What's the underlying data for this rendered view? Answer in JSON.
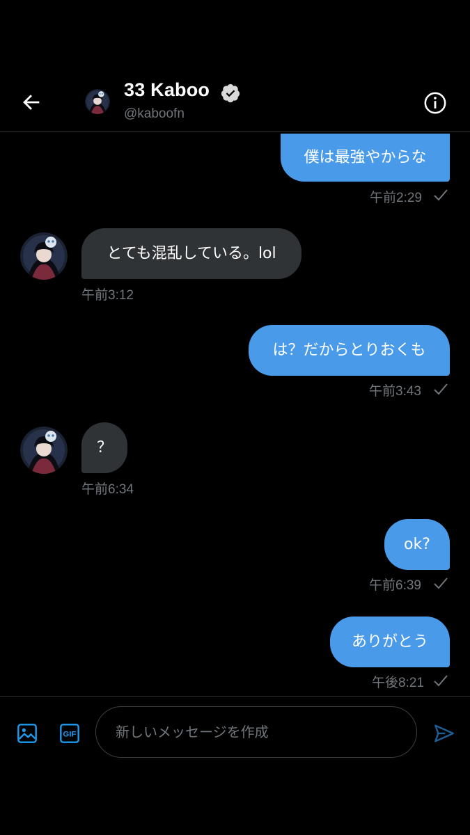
{
  "header": {
    "display_name": "33 Kaboo",
    "handle": "@kaboofn",
    "back_icon": "arrow-left-icon",
    "verified_icon": "verified-badge-icon",
    "info_icon": "info-circle-icon"
  },
  "messages": [
    {
      "direction": "sent",
      "text": "僕は最強やからな",
      "time": "午前2:29",
      "read": true
    },
    {
      "direction": "received",
      "text": "とても混乱している。lol",
      "time": "午前3:12"
    },
    {
      "direction": "sent",
      "text": "は？だからとりおくも",
      "time": "午前3:43",
      "read": true
    },
    {
      "direction": "received",
      "text": "？",
      "time": "午前6:34"
    },
    {
      "direction": "sent",
      "text": "ok?",
      "time": "午前6:39",
      "read": true
    },
    {
      "direction": "sent",
      "text": "ありがとう",
      "time": "午後8:21",
      "read": true
    }
  ],
  "composer": {
    "placeholder": "新しいメッセージを作成",
    "media_icon": "image-icon",
    "gif_icon": "gif-icon",
    "send_icon": "send-icon"
  },
  "colors": {
    "background": "#000000",
    "sent_bubble": "#4a9aea",
    "received_bubble": "#2f3336",
    "muted_text": "#71767b",
    "accent": "#1d9bf0"
  }
}
